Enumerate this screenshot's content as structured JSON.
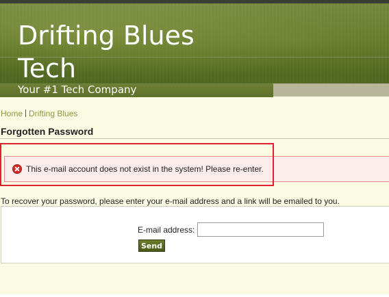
{
  "site": {
    "title": "Drifting Blues Tech",
    "tagline": "Your #1 Tech Company"
  },
  "breadcrumb": {
    "home": "Home",
    "current": "Drifting Blues"
  },
  "page": {
    "title": "Forgotten Password"
  },
  "error": {
    "message": "This e-mail account does not exist in the system! Please re-enter."
  },
  "form": {
    "instructions": "To recover your password, please enter your e-mail address and a link will be emailed to you.",
    "email_label": "E-mail address:",
    "email_value": "",
    "send_label": "Send"
  },
  "colors": {
    "header_green": "#5d7326",
    "link_green": "#8a9b3c",
    "error_red": "#d02b2b",
    "highlight_red": "#e0202f",
    "page_background": "#fbfbe4"
  }
}
